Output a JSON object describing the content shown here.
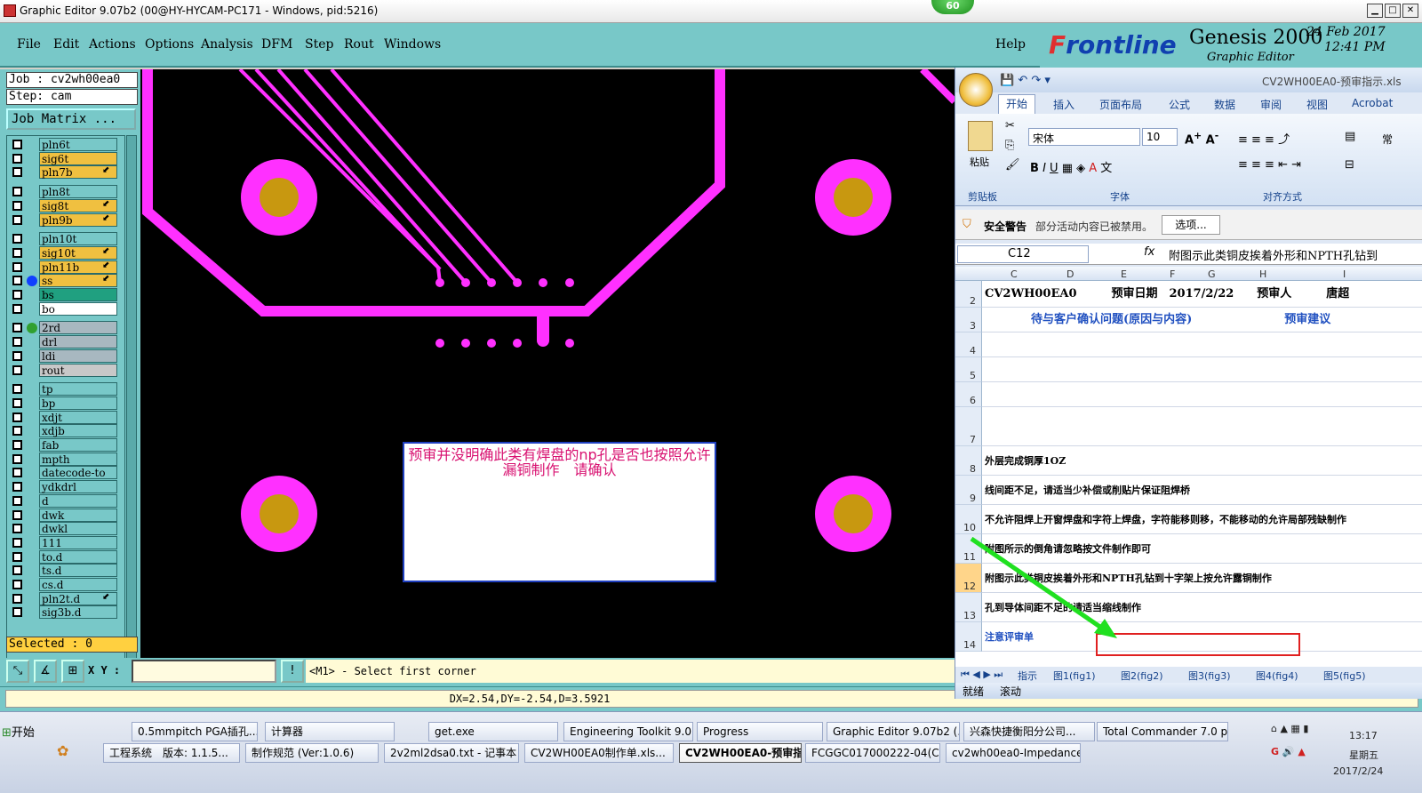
{
  "window": {
    "title": "Graphic Editor 9.07b2 (00@HY-HYCAM-PC171 - Windows, pid:5216)",
    "badge": "60"
  },
  "menu": {
    "items": [
      "File",
      "Edit",
      "Actions",
      "Options",
      "Analysis",
      "DFM",
      "Step",
      "Rout",
      "Windows"
    ],
    "help": "Help"
  },
  "logo": {
    "brand_a": "F",
    "brand_b": "rontline",
    "product": "Genesis 2000",
    "subtitle": "Graphic Editor",
    "date": "24 Feb 2017",
    "time": "12:41 PM"
  },
  "left": {
    "job": "Job : cv2wh00ea0",
    "step": "Step: cam",
    "job_matrix": "Job Matrix ...",
    "selected": "Selected : 0",
    "layers": [
      {
        "name": "pln6t",
        "color": "#78c8c8",
        "tag": ""
      },
      {
        "name": "sig6t",
        "color": "#f0c040",
        "tag": ""
      },
      {
        "name": "pln7b",
        "color": "#f0c040",
        "tag": "⬋"
      },
      {
        "name": "pln8t",
        "color": "#78c8c8",
        "tag": ""
      },
      {
        "name": "sig8t",
        "color": "#f0c040",
        "tag": "⬋"
      },
      {
        "name": "pln9b",
        "color": "#f0c040",
        "tag": "⬋"
      },
      {
        "name": "pln10t",
        "color": "#78c8c8",
        "tag": ""
      },
      {
        "name": "sig10t",
        "color": "#f0c040",
        "tag": "⬋"
      },
      {
        "name": "pln11b",
        "color": "#f0c040",
        "tag": "⬋"
      },
      {
        "name": "ss",
        "color": "#f0c040",
        "tag": "⬋",
        "dot": "#1040ff"
      },
      {
        "name": "bs",
        "color": "#20a080",
        "tag": ""
      },
      {
        "name": "bo",
        "color": "#ffffff",
        "tag": ""
      },
      {
        "name": "2rd",
        "color": "#a8b8c0",
        "tag": "",
        "dot": "#30a030"
      },
      {
        "name": "drl",
        "color": "#a8b8c0",
        "tag": ""
      },
      {
        "name": "ldi",
        "color": "#a8b8c0",
        "tag": ""
      },
      {
        "name": "rout",
        "color": "#c8c8c8",
        "tag": ""
      },
      {
        "name": "tp",
        "color": "#78c8c8",
        "tag": ""
      },
      {
        "name": "bp",
        "color": "#78c8c8",
        "tag": ""
      },
      {
        "name": "xdjt",
        "color": "#78c8c8",
        "tag": ""
      },
      {
        "name": "xdjb",
        "color": "#78c8c8",
        "tag": ""
      },
      {
        "name": "fab",
        "color": "#78c8c8",
        "tag": ""
      },
      {
        "name": "mpth",
        "color": "#78c8c8",
        "tag": ""
      },
      {
        "name": "datecode-to",
        "color": "#78c8c8",
        "tag": ""
      },
      {
        "name": "ydkdrl",
        "color": "#78c8c8",
        "tag": ""
      },
      {
        "name": "d",
        "color": "#78c8c8",
        "tag": ""
      },
      {
        "name": "dwk",
        "color": "#78c8c8",
        "tag": ""
      },
      {
        "name": "dwkl",
        "color": "#78c8c8",
        "tag": ""
      },
      {
        "name": "111",
        "color": "#78c8c8",
        "tag": ""
      },
      {
        "name": "to.d",
        "color": "#78c8c8",
        "tag": ""
      },
      {
        "name": "ts.d",
        "color": "#78c8c8",
        "tag": ""
      },
      {
        "name": "cs.d",
        "color": "#78c8c8",
        "tag": ""
      },
      {
        "name": "pln2t.d",
        "color": "#78c8c8",
        "tag": "⬋"
      },
      {
        "name": "sig3b.d",
        "color": "#78c8c8",
        "tag": ""
      }
    ]
  },
  "canvas": {
    "note": "预审并没明确此类有焊盘的np孔是否也按照允许漏铜制作　请确认"
  },
  "status": {
    "xy_label": "X Y :",
    "xy_value": "",
    "prompt": "<M1> - Select first corner",
    "dx": "DX=2.54,DY=-2.54,D=3.5921"
  },
  "excel": {
    "filename": "CV2WH00EA0-预审指示.xls",
    "tabs": [
      "开始",
      "插入",
      "页面布局",
      "公式",
      "数据",
      "审阅",
      "视图",
      "Acrobat"
    ],
    "font_name": "宋体",
    "font_size": "10",
    "paste": "粘贴",
    "groups": [
      "剪贴板",
      "字体",
      "对齐方式"
    ],
    "wrap_label": "常",
    "security_title": "安全警告",
    "security_text": "部分活动内容已被禁用。",
    "security_btn": "选项...",
    "cell_ref": "C12",
    "fx": "fx",
    "formula": "附图示此类铜皮挨着外形和NPTH孔钻到",
    "columns": [
      "C",
      "D",
      "E",
      "F",
      "G",
      "H",
      "I"
    ],
    "rows": [
      {
        "n": "2",
        "text": "CV2WH00EA0　　　预审日期　2017/2/22　　预审人　　　唐超"
      },
      {
        "n": "3",
        "text": "　　　　待与客户确认问题(原因与内容)　　　　　　　　预审建议"
      },
      {
        "n": "4",
        "text": ""
      },
      {
        "n": "5",
        "text": ""
      },
      {
        "n": "6",
        "text": ""
      },
      {
        "n": "7",
        "text": ""
      },
      {
        "n": "8",
        "text": "外层完成铜厚1OZ"
      },
      {
        "n": "9",
        "text": "线间距不足，请适当少补偿或削贴片保证阻焊桥"
      },
      {
        "n": "10",
        "text": "不允许阻焊上开窗焊盘和字符上焊盘，字符能移则移，不能移动的允许局部残缺制作"
      },
      {
        "n": "11",
        "text": "附图所示的倒角请忽略按文件制作即可"
      },
      {
        "n": "12",
        "text": "附图示此类铜皮挨着外形和NPTH孔钻到十字架上按允许露铜制作"
      },
      {
        "n": "13",
        "text": "孔到导体间距不足的请适当缩线制作"
      },
      {
        "n": "14",
        "text": "注意评审单"
      }
    ],
    "sheet_tabs": [
      "指示",
      "图1(fig1)",
      "图2(fig2)",
      "图3(fig3)",
      "图4(fig4)",
      "图5(fig5)"
    ],
    "status_left": "就绪",
    "status_right": "滚动"
  },
  "taskbar": {
    "start": "开始",
    "row1": [
      "0.5mmpitch PGA插孔...",
      "计算器",
      "get.exe",
      "Engineering Toolkit 9.0...",
      "Progress",
      "Graphic Editor 9.07b2 (...",
      "兴森快捷衡阳分公司...",
      "Total Commander 7.0 p..."
    ],
    "row2": [
      "工程系统　版本: 1.1.5...",
      "制作规范 (Ver:1.0.6)",
      "2v2ml2dsa0.txt - 记事本",
      "CV2WH00EA0制作单.xls...",
      "CV2WH00EA0-预审指...",
      "FCGGC017000222-04(C...",
      "cv2wh00ea0-Impedance..."
    ],
    "time": "13:17",
    "weekday": "星期五",
    "date": "2017/2/24"
  }
}
